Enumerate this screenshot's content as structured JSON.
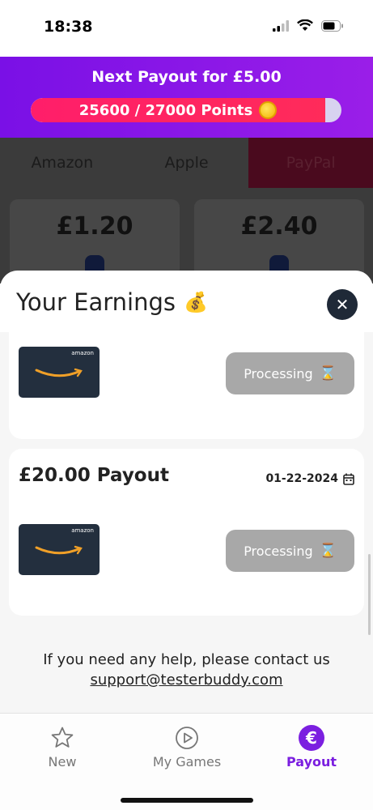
{
  "status_bar": {
    "time": "18:38"
  },
  "header": {
    "payout_text": "Next Payout for £5.00",
    "points_text": "25600 / 27000 Points",
    "progress_fraction": 0.948
  },
  "tabs": [
    {
      "label": "Amazon",
      "active": false
    },
    {
      "label": "Apple",
      "active": false
    },
    {
      "label": "PayPal",
      "active": true
    }
  ],
  "reward_cards": [
    {
      "value": "£1.20"
    },
    {
      "value": "£2.40"
    }
  ],
  "earnings": {
    "title": "Your Earnings",
    "title_emoji": "💰",
    "close_icon": "close-icon",
    "entries": [
      {
        "title": "",
        "date": "",
        "status": "Processing",
        "status_emoji": "⌛",
        "brand": "amazon"
      },
      {
        "title": "£20.00 Payout",
        "date": "01-22-2024",
        "status": "Processing",
        "status_emoji": "⌛",
        "brand": "amazon"
      }
    ],
    "help_text": "If you need any help, please contact us",
    "help_email": "support@testerbuddy.com"
  },
  "bottom_nav": [
    {
      "label": "New",
      "icon": "star-icon",
      "active": false
    },
    {
      "label": "My Games",
      "icon": "play-circle-icon",
      "active": false
    },
    {
      "label": "Payout",
      "icon": "euro-icon",
      "active": true
    }
  ],
  "colors": {
    "accent": "#7b1fe0",
    "progress": "#ff1e6a",
    "status_button": "#a8a8a8"
  }
}
